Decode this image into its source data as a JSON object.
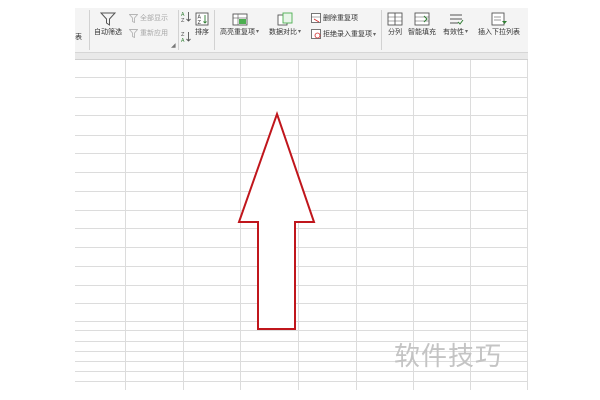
{
  "ribbon": {
    "partial_label": "表",
    "auto_filter": "自动筛选",
    "show_all": "全部显示",
    "reapply": "重新应用",
    "sort": "排序",
    "highlight_duplicates": "高亮重复项",
    "data_compare": "数据对比",
    "remove_duplicates": "删除重复项",
    "reject_duplicates": "拒绝录入重复项",
    "split_column": "分列",
    "smart_fill": "智能填充",
    "validity": "有效性",
    "insert_dropdown": "插入下拉列表"
  },
  "overlay": {
    "arrow_color": "#c0161c",
    "arrow_direction": "up"
  },
  "watermark": "软件技巧"
}
